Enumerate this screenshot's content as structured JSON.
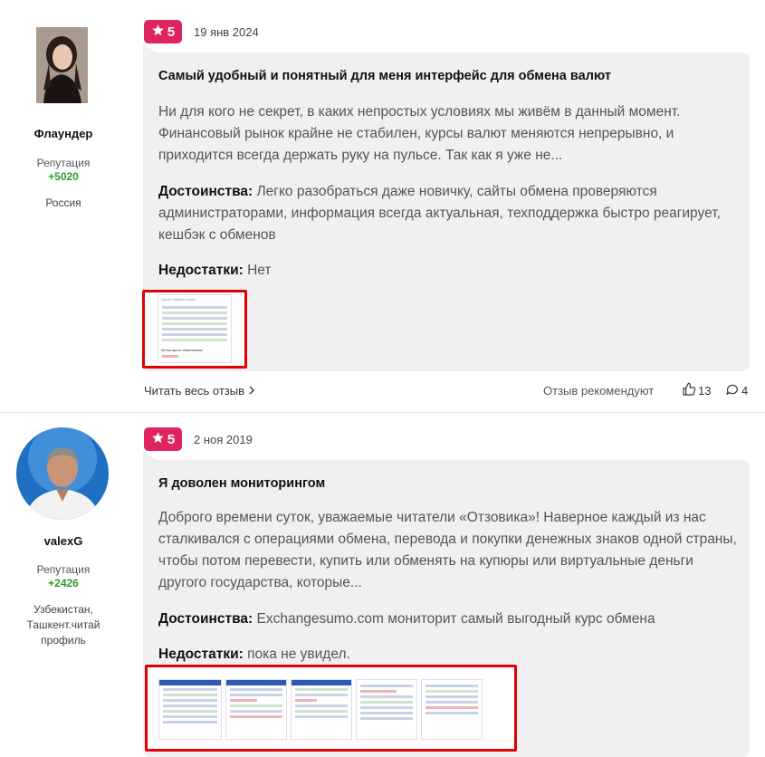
{
  "reviews": [
    {
      "author": {
        "name": "Флаундер",
        "rep_label": "Репутация",
        "rep_value": "+5020",
        "location": "Россия"
      },
      "rating": "5",
      "date": "19 янв 2024",
      "title": "Самый удобный и понятный для меня интерфейс для обмена валют",
      "body": "Ни для кого не секрет, в каких непростых условиях мы живём в данный момент. Финансовый рынок крайне не стабилен, курсы валют меняются непрерывно, и приходится всегда держать руку на пульсе. Так как я уже не...",
      "pros_label": "Достоинства:",
      "pros": "Легко разобраться даже новичку, сайты обмена проверяются администраторами, информация всегда актуальная, техподдержка быстро реагирует, кешбэк с обменов",
      "cons_label": "Недостатки:",
      "cons": "Нет",
      "read_more": "Читать весь отзыв",
      "recommend_label": "Отзыв рекомендуют",
      "likes": "13",
      "comments": "4",
      "thumbnail_text": [
        "Курсы обмена валют",
        "Мониторинг обменников"
      ]
    },
    {
      "author": {
        "name": "valexG",
        "rep_label": "Репутация",
        "rep_value": "+2426",
        "location": "Узбекистан, Ташкент.читай профиль"
      },
      "rating": "5",
      "date": "2 ноя 2019",
      "title": "Я доволен мониторингом",
      "body": "Доброго времени суток, уважаемые читатели «Отзовика»! Наверное каждый из нас сталкивался с операциями обмена, перевода и покупки денежных знаков одной страны, чтобы потом перевести, купить или обменять на купюры или виртуальные деньги другого государства, которые...",
      "pros_label": "Достоинства:",
      "pros": "Exchangesumo.com мониторит самый выгодный курс обмена",
      "cons_label": "Недостатки:",
      "cons": "пока не увидел."
    }
  ],
  "colors": {
    "badge": "#e0245e",
    "highlight_border": "#e30000",
    "bubble": "#f0f0f3",
    "reputation": "#2a9d2a"
  },
  "icons": [
    "star-icon",
    "chevron-right-icon",
    "thumbs-up-icon",
    "comment-icon"
  ]
}
